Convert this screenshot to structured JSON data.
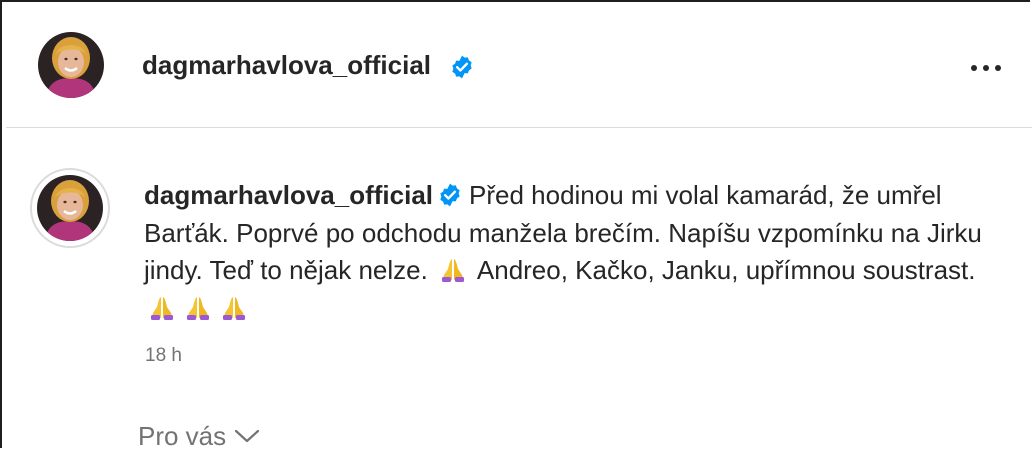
{
  "post": {
    "username": "dagmarhavlova_official",
    "verified": true,
    "more_icon": "more-horizontal-icon"
  },
  "caption": {
    "username": "dagmarhavlova_official",
    "text_1": "Před hodinou mi volal kamarád, že umřel Barťák. Poprvé po odchodu manžela brečím. Napíšu vzpomínku na Jirku jindy. Teď to nějak nelze.",
    "text_2": "Andreo, Kačko, Janku, upřímnou soustrast.",
    "emoji": "folded-hands-emoji",
    "time": "18 h"
  },
  "footer": {
    "for_you_label": "Pro vás",
    "chevron_icon": "chevron-down-icon"
  },
  "colors": {
    "text": "#262626",
    "muted": "#737373",
    "verified": "#0095f6",
    "divider": "#dbdbdb"
  }
}
